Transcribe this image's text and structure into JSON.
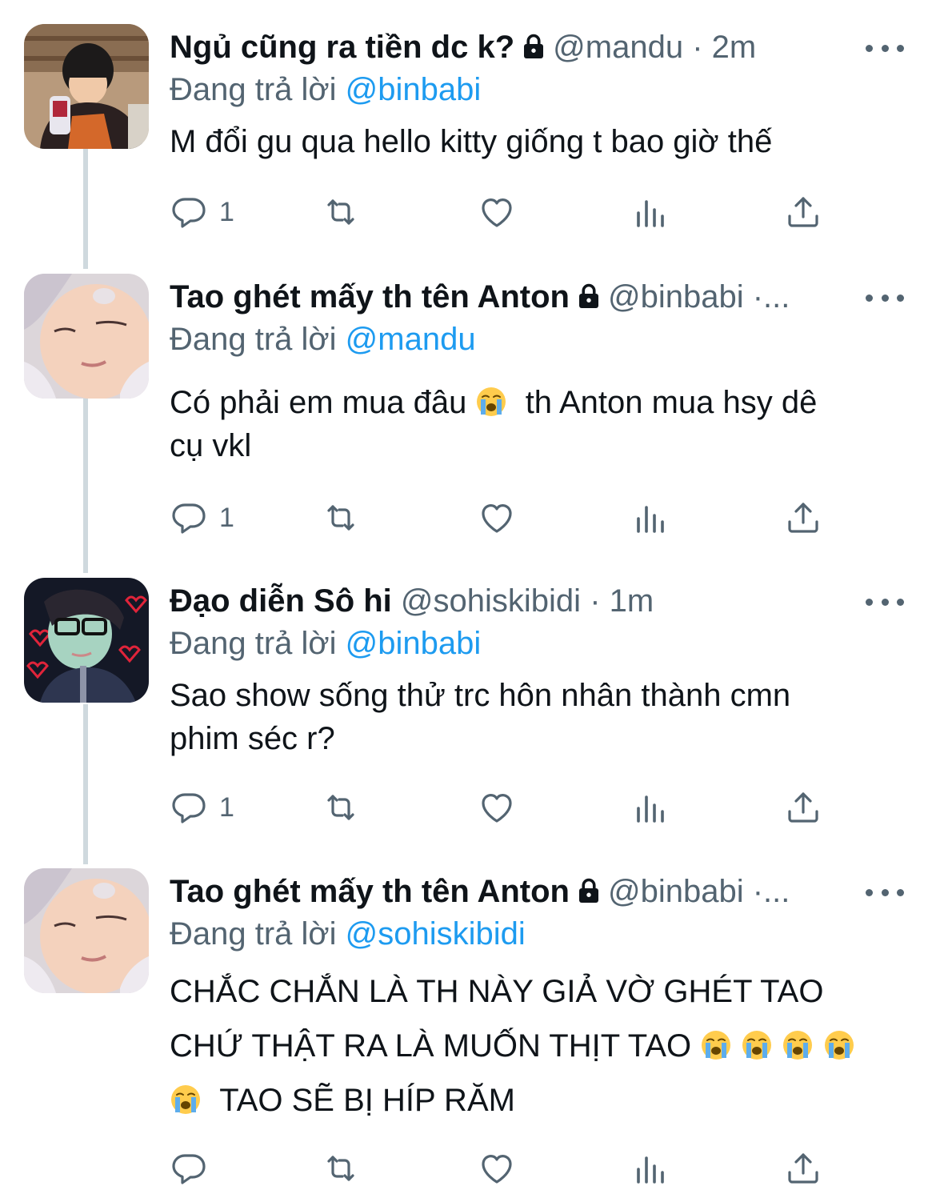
{
  "replying_label": "Đang trả lời",
  "tweets": [
    {
      "name": "Ngủ cũng ra tiền dc k?",
      "handle": "@mandu",
      "dot": "·",
      "time": "2m",
      "reply_to": "@binbabi",
      "text_lines": [
        "M đổi gu qua hello kitty giống t bao giờ thế"
      ],
      "reply_count": "1",
      "avatar": "avatar-child-jacket"
    },
    {
      "name": "Tao ghét mấy th tên Anton",
      "handle": "@binbabi",
      "dot": "·...",
      "time": "",
      "reply_to": "@mandu",
      "text_lines": [
        "Có phải em mua đâu",
        "th Anton mua hsy dê",
        "cụ vkl"
      ],
      "reply_count": "1",
      "avatar": "avatar-sleeping-child"
    },
    {
      "name": "Đạo diễn Sô hi",
      "handle": "@sohiskibidi",
      "dot": "·",
      "time": "1m",
      "reply_to": "@binbabi",
      "text_lines": [
        "Sao show sống thử trc hôn nhân thành cmn",
        "phim séc r?"
      ],
      "reply_count": "1",
      "avatar": "avatar-hearts"
    },
    {
      "name": "Tao ghét mấy th tên Anton",
      "handle": "@binbabi",
      "dot": "·...",
      "time": "",
      "reply_to": "@sohiskibidi",
      "text_lines": [
        "CHẮC CHẮN LÀ TH NÀY GIẢ VỜ GHÉT TAO",
        "CHỨ THẬT RA LÀ MUỐN THỊT TAO",
        "TAO SẼ BỊ HÍP RĂM"
      ],
      "reply_count": "",
      "avatar": "avatar-sleeping-child"
    }
  ],
  "colors": {
    "accent": "#1d9bf0",
    "secondary_text": "#536471",
    "thread_line": "#cfd9de"
  },
  "icons": [
    "reply-icon",
    "retweet-icon",
    "like-icon",
    "views-icon",
    "share-icon",
    "lock-icon",
    "more-icon",
    "crying-emoji"
  ]
}
